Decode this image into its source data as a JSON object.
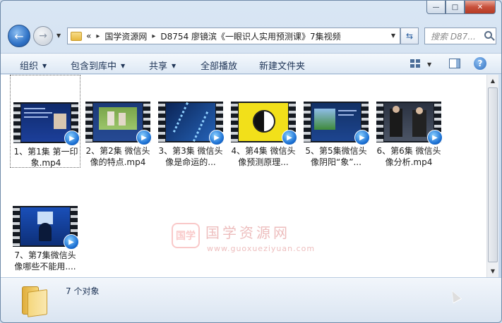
{
  "window": {
    "caption": {
      "minimize": "—",
      "maximize": "□",
      "close": "✕"
    }
  },
  "nav": {
    "back_glyph": "←",
    "forward_glyph": "→",
    "crumbs": [
      "国学资源网",
      "D8754 廖镜滨《一眼识人实用预测课》7集视频"
    ],
    "crumb_lead": "«",
    "crumb_sep": "▸",
    "search_placeholder": "搜索 D87..."
  },
  "toolbar": {
    "organize": "组织",
    "include_library": "包含到库中",
    "share": "共享",
    "play_all": "全部播放",
    "new_folder": "新建文件夹"
  },
  "items": [
    {
      "label": "1、第1集  第一印象.mp4",
      "selected": true
    },
    {
      "label": "2、第2集  微信头像的特点.mp4",
      "selected": false
    },
    {
      "label": "3、第3集  微信头像是命运的...",
      "selected": false
    },
    {
      "label": "4、第4集  微信头像预测原理...",
      "selected": false
    },
    {
      "label": "5、第5集微信头像阴阳“象”...",
      "selected": false
    },
    {
      "label": "6、第6集  微信头像分析.mp4",
      "selected": false
    },
    {
      "label": "7、第7集微信头像哪些不能用....",
      "selected": false
    }
  ],
  "status": {
    "count_text": "7 个对象"
  },
  "watermark": {
    "box": "国学",
    "text": "国学资源网",
    "url": "www.guoxueziyuan.com"
  },
  "colors": {
    "accent": "#2f72c6",
    "close": "#c7503b",
    "badge": "#1a6fd3"
  }
}
